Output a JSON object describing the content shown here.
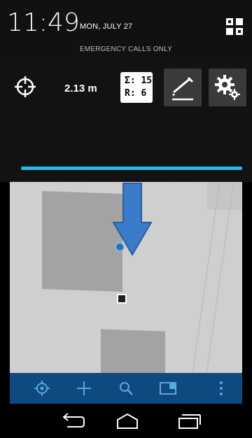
{
  "status_bar": {
    "time": "11:49",
    "date": "MON, JULY 27",
    "emergency_text": "EMERGENCY CALLS ONLY",
    "quick_settings_icon": "grid-icon"
  },
  "gps_panel": {
    "accuracy": "2.13 m",
    "satellites_line1": "Σ: 15",
    "satellites_line2": "R:  6",
    "gps_icon": "crosshair-icon",
    "layer_button_icon": "pen-layer-icon",
    "settings_button_icon": "gear-icon",
    "progress_fraction": 1.0,
    "accent_color": "#2bb4e8"
  },
  "map": {
    "background_color": "#cfcfcf",
    "building_color": "#a3a3a3",
    "marker_color": "#2e6fb7",
    "overlay_arrow_color": "#3a7cc9"
  },
  "toolbar": {
    "background_color": "#0e4a80",
    "items": [
      {
        "name": "locate",
        "icon": "target-icon"
      },
      {
        "name": "add",
        "icon": "plus-icon"
      },
      {
        "name": "search",
        "icon": "search-icon"
      },
      {
        "name": "layers",
        "icon": "panel-icon"
      },
      {
        "name": "more",
        "icon": "overflow-icon"
      }
    ]
  },
  "nav_bar": {
    "items": [
      {
        "name": "back",
        "icon": "back-icon"
      },
      {
        "name": "home",
        "icon": "home-icon"
      },
      {
        "name": "recents",
        "icon": "recents-icon"
      }
    ]
  }
}
